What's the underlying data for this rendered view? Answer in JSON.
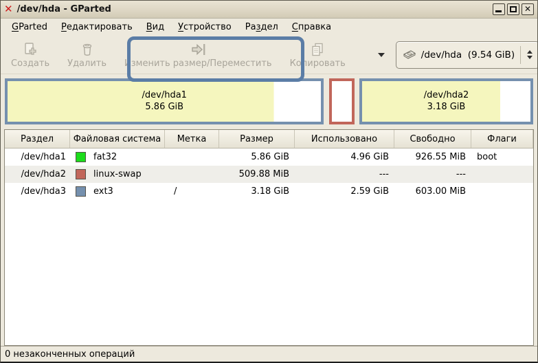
{
  "window": {
    "title": "/dev/hda - GParted",
    "icon": "gparted-window-icon",
    "controls": [
      "minimize-icon",
      "maximize-icon",
      "close-icon"
    ]
  },
  "menubar": {
    "items": [
      {
        "label": "GParted",
        "mnemonic": 0
      },
      {
        "label": "Редактировать",
        "mnemonic": 0
      },
      {
        "label": "Вид",
        "mnemonic": 0
      },
      {
        "label": "Устройство",
        "mnemonic": 0
      },
      {
        "label": "Раздел",
        "mnemonic": 2
      },
      {
        "label": "Справка",
        "mnemonic": 0
      }
    ]
  },
  "toolbar": {
    "buttons": [
      {
        "id": "new",
        "label": "Создать",
        "icon": "new-partition-icon",
        "disabled": true,
        "highlighted": false
      },
      {
        "id": "delete",
        "label": "Удалить",
        "icon": "delete-icon",
        "disabled": true,
        "highlighted": false
      },
      {
        "id": "resize-move",
        "label": "Изменить размер/Переместить",
        "icon": "resize-move-icon",
        "disabled": true,
        "highlighted": true
      },
      {
        "id": "copy",
        "label": "Копировать",
        "icon": "copy-icon",
        "disabled": true,
        "highlighted": false
      }
    ],
    "overflow_icon": "chevron-down-icon",
    "device_selector": {
      "icon": "harddisk-icon",
      "value": "/dev/hda  (9.54 GiB)"
    }
  },
  "visual_bar": {
    "used_color": "#F5F6BE",
    "free_color": "#FFFFFF",
    "partitions": [
      {
        "name": "/dev/hda1",
        "size": "5.86 GiB",
        "border_color": "#7590AE",
        "used_percent": 85,
        "width_percent": 60.4
      },
      {
        "name": "",
        "size": "",
        "border_color": "#C1665A",
        "used_percent": 0,
        "width_percent": 4.8
      },
      {
        "name": "/dev/hda2",
        "size": "3.18 GiB",
        "border_color": "#7590AE",
        "used_percent": 82,
        "width_percent": 32.9
      }
    ]
  },
  "table": {
    "headers": [
      "Раздел",
      "Файловая система",
      "Метка",
      "Размер",
      "Использовано",
      "Свободно",
      "Флаги"
    ],
    "rows": [
      {
        "partition": "/dev/hda1",
        "filesystem": "fat32",
        "fs_color": "#1CDC1C",
        "label": "",
        "size": "5.86 GiB",
        "used": "4.96 GiB",
        "free": "926.55 MiB",
        "flags": "boot"
      },
      {
        "partition": "/dev/hda2",
        "filesystem": "linux-swap",
        "fs_color": "#C1665A",
        "label": "",
        "size": "509.88 MiB",
        "used": "---",
        "free": "---",
        "flags": ""
      },
      {
        "partition": "/dev/hda3",
        "filesystem": "ext3",
        "fs_color": "#7590AE",
        "label": "/",
        "size": "3.18 GiB",
        "used": "2.59 GiB",
        "free": "603.00 MiB",
        "flags": ""
      }
    ]
  },
  "statusbar": {
    "text": "0 незаконченных операций"
  },
  "annotation": {
    "target": "resize-move-button",
    "color": "#5B7DA6"
  }
}
